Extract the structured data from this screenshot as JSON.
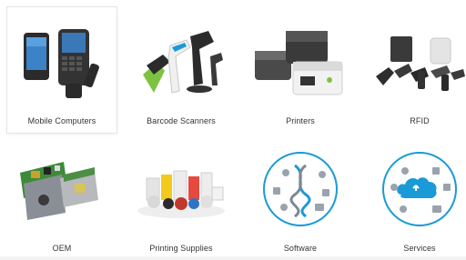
{
  "categories": {
    "items": [
      {
        "label": "Mobile Computers",
        "icon": "mobile-computers-product-image"
      },
      {
        "label": "Barcode Scanners",
        "icon": "barcode-scanners-product-image"
      },
      {
        "label": "Printers",
        "icon": "printers-product-image"
      },
      {
        "label": "RFID",
        "icon": "rfid-product-image"
      },
      {
        "label": "OEM",
        "icon": "oem-product-image"
      },
      {
        "label": "Printing Supplies",
        "icon": "printing-supplies-product-image"
      },
      {
        "label": "Software",
        "icon": "software-icon"
      },
      {
        "label": "Services",
        "icon": "services-icon"
      }
    ],
    "active_index": 0
  },
  "colors": {
    "accent_blue": "#1a9ad6",
    "scanner_green": "#7ec242",
    "device_dark": "#2b2b2b",
    "tile_bg": "#ffffff",
    "page_bg": "#f4f4f4"
  }
}
